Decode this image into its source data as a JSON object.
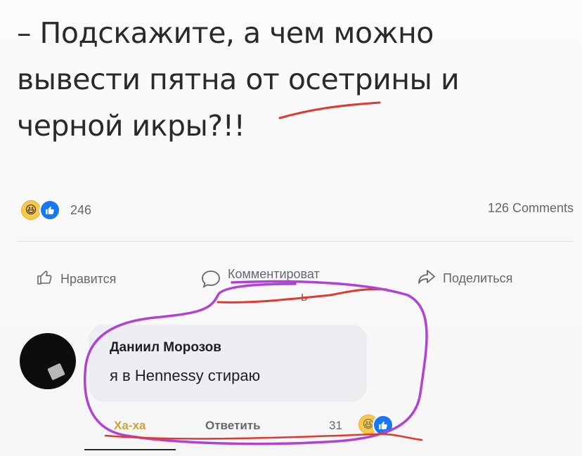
{
  "post": {
    "lines": [
      "– Подскажите, а чем можно",
      "вывести пятна от осетрины и",
      "черной икры?!!"
    ]
  },
  "reactions": {
    "count": "246",
    "icons": [
      "haha-icon",
      "like-icon"
    ],
    "comments": "126 Comments"
  },
  "actions": {
    "like": "Нравится",
    "comment": "Комментироват",
    "comment_tail": "ь",
    "share": "Поделиться"
  },
  "comment": {
    "author": "Даниил Морозов",
    "text": "я в Hennessy стираю",
    "haha": "Ха-ха",
    "reply": "Ответить",
    "count": "31"
  },
  "colors": {
    "text": "#2a2a2a",
    "meta": "#65676b",
    "like": "#1877f2",
    "haha": "#f7c948",
    "bubble": "#eceef1",
    "marker_red": "#e0392f",
    "marker_purple": "#b042d6"
  }
}
